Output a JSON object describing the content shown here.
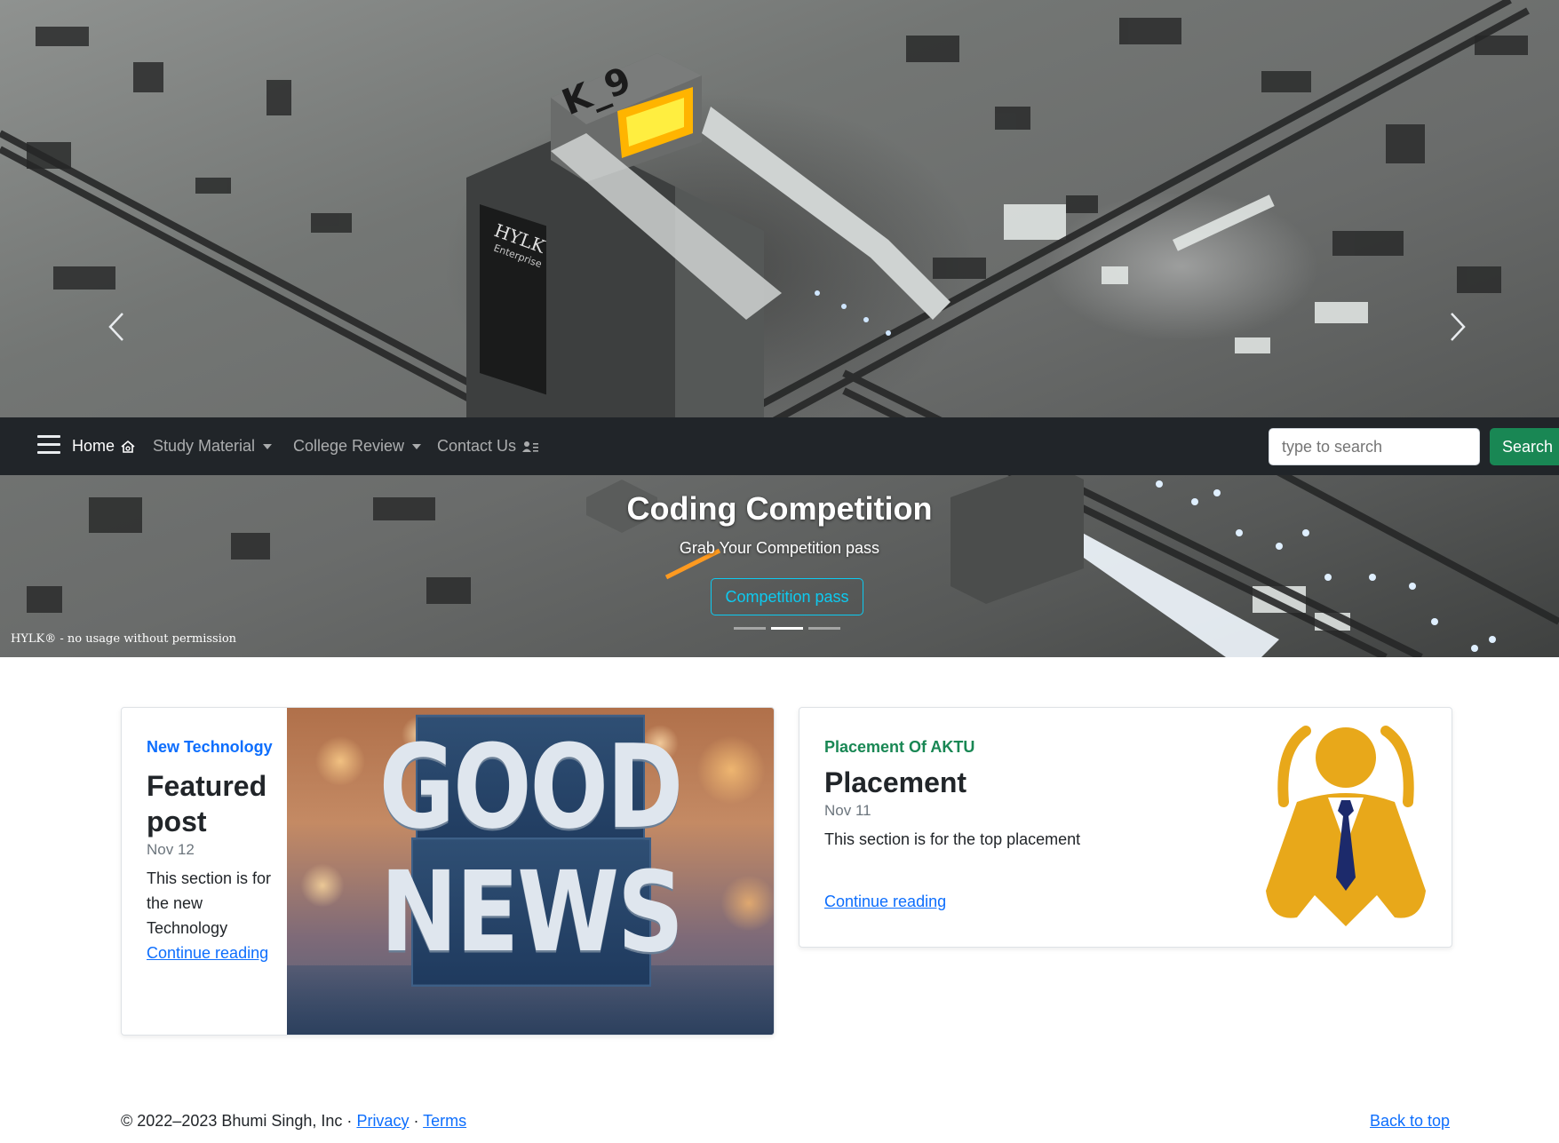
{
  "hero": {
    "title": "Coding Competition",
    "subtitle": "Grab Your Competition pass",
    "button_label": "Competition pass",
    "watermark": "HYLK® - no usage without permission",
    "slide_count": 3,
    "active_slide": 2,
    "prev_icon": "chevron-left-icon",
    "next_icon": "chevron-right-icon",
    "scene_text": {
      "sign": "K_9",
      "brand": "HYLK",
      "brand_sub": "Enterprise"
    }
  },
  "navbar": {
    "menu_icon": "hamburger-icon",
    "items": [
      {
        "label": "Home",
        "icon": "house-icon",
        "active": true
      },
      {
        "label": "Study Material",
        "dropdown": true
      },
      {
        "label": "College Review",
        "dropdown": true
      },
      {
        "label": "Contact Us",
        "icon": "person-lines-icon"
      }
    ],
    "search": {
      "placeholder": "type to search",
      "button_label": "Search"
    }
  },
  "posts": [
    {
      "category": "New Technology",
      "title": "Featured post",
      "date": "Nov 12",
      "description": "This section is for the new Technology",
      "link_label": "Continue reading",
      "image_text": {
        "line1": "GOOD",
        "line2": "NEWS"
      }
    },
    {
      "category": "Placement Of AKTU",
      "title": "Placement",
      "date": "Nov 11",
      "description": "This section is for the top placement",
      "link_label": "Continue reading",
      "image_icon": "businessman-icon"
    }
  ],
  "footer": {
    "copyright": "© 2022–2023 Bhumi Singh, Inc · ",
    "privacy": "Privacy",
    "separator": " · ",
    "terms": "Terms",
    "back_to_top": "Back to top"
  },
  "colors": {
    "navbar_bg": "#212529",
    "link": "#0d6efd",
    "success": "#198754",
    "caption_button": "#0dcaf0",
    "placement_gold": "#e8a81a",
    "placement_tie": "#1c2a6b"
  }
}
